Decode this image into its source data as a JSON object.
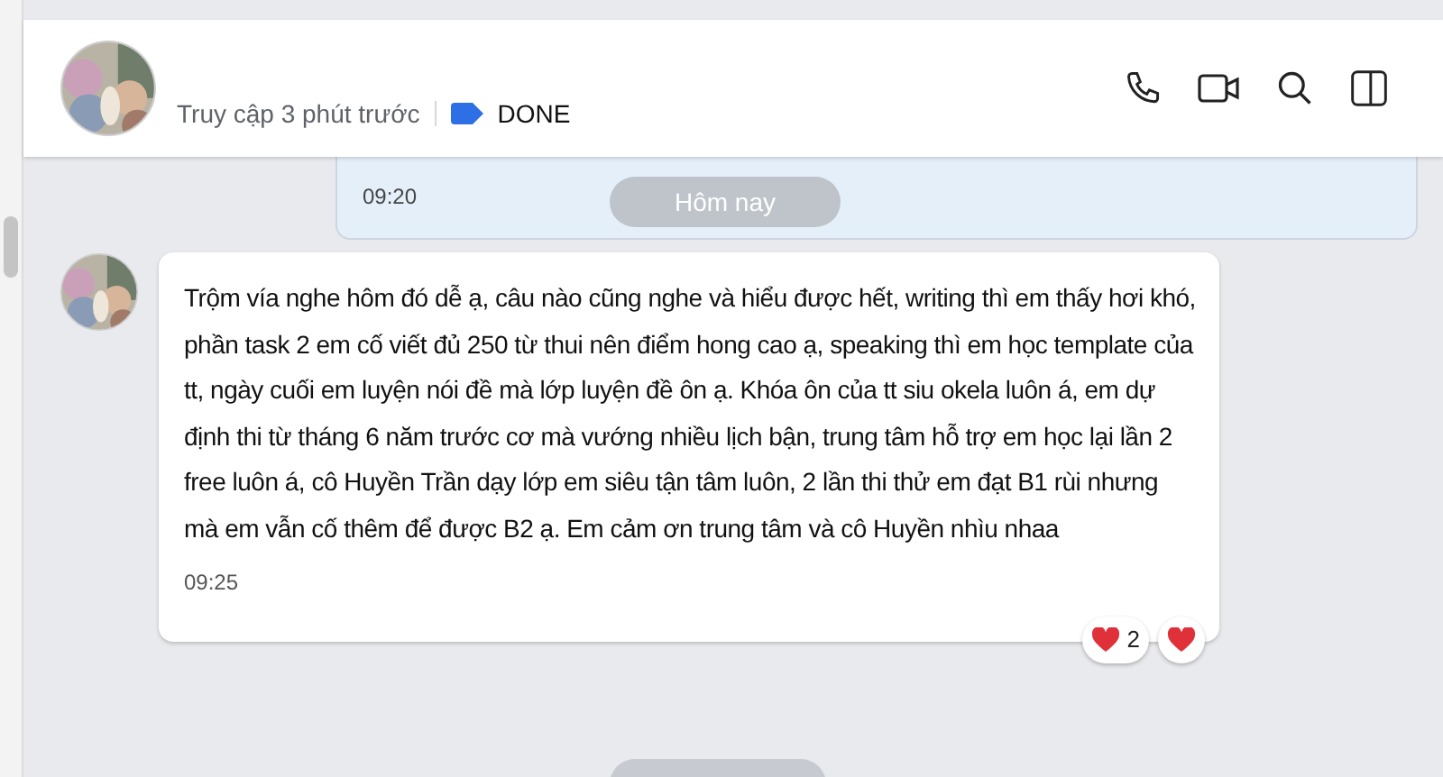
{
  "header": {
    "last_seen": "Truy cập 3 phút trước",
    "tag": {
      "label": "DONE",
      "color": "#2f6fe6"
    }
  },
  "previous_message": {
    "time": "09:20"
  },
  "date_divider": "Hôm nay",
  "message": {
    "text": "Trộm vía nghe hôm đó dễ ạ, câu nào cũng nghe và hiểu được hết, writing thì em thấy hơi khó, phần task 2 em cố viết đủ 250 từ thui nên điểm hong cao ạ, speaking thì em học template của tt, ngày cuối em luyện nói đề mà lớp luyện đề ôn ạ. Khóa ôn của tt siu okela luôn á, em dự định thi từ tháng 6 năm trước cơ mà vướng nhiều lịch bận, trung tâm hỗ trợ em học lại lần 2 free luôn á, cô Huyền Trần dạy lớp em siêu tận tâm luôn, 2 lần thi thử em đạt B1 rùi nhưng mà em vẫn cố thêm để được B2 ạ. Em cảm ơn trung tâm và cô Huyền nhìu nhaa",
    "time": "09:25",
    "reactions": [
      {
        "kind": "heart",
        "count": "2"
      },
      {
        "kind": "heart"
      }
    ]
  }
}
